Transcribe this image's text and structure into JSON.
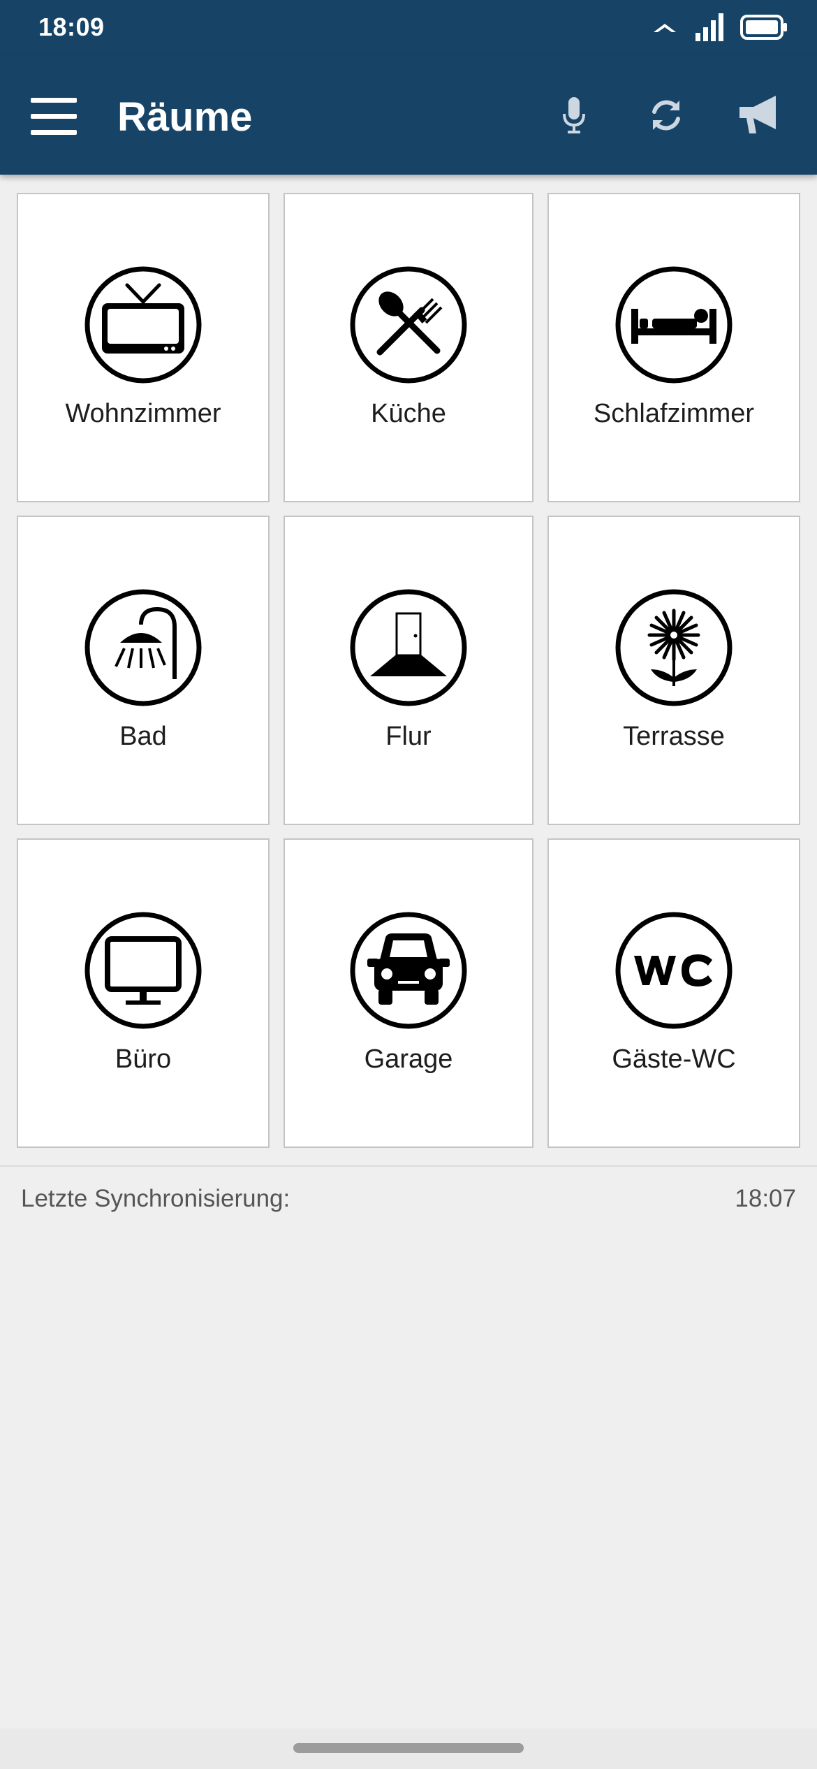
{
  "status_bar": {
    "time": "18:09",
    "icons": [
      "network-arrow-icon",
      "signal-icon",
      "battery-icon"
    ]
  },
  "app_bar": {
    "title": "Räume",
    "actions": [
      "microphone-icon",
      "refresh-icon",
      "megaphone-icon"
    ],
    "background": "#174466"
  },
  "rooms": [
    {
      "label": "Wohnzimmer",
      "icon": "tv-icon"
    },
    {
      "label": "Küche",
      "icon": "cutlery-icon"
    },
    {
      "label": "Schlafzimmer",
      "icon": "bed-icon"
    },
    {
      "label": "Bad",
      "icon": "shower-icon"
    },
    {
      "label": "Flur",
      "icon": "hallway-door-icon"
    },
    {
      "label": "Terrasse",
      "icon": "flower-icon"
    },
    {
      "label": "Büro",
      "icon": "monitor-icon"
    },
    {
      "label": "Garage",
      "icon": "car-icon"
    },
    {
      "label": "Gäste-WC",
      "icon": "wc-icon"
    }
  ],
  "footer": {
    "sync_label": "Letzte Synchronisierung:",
    "sync_time": "18:07"
  }
}
